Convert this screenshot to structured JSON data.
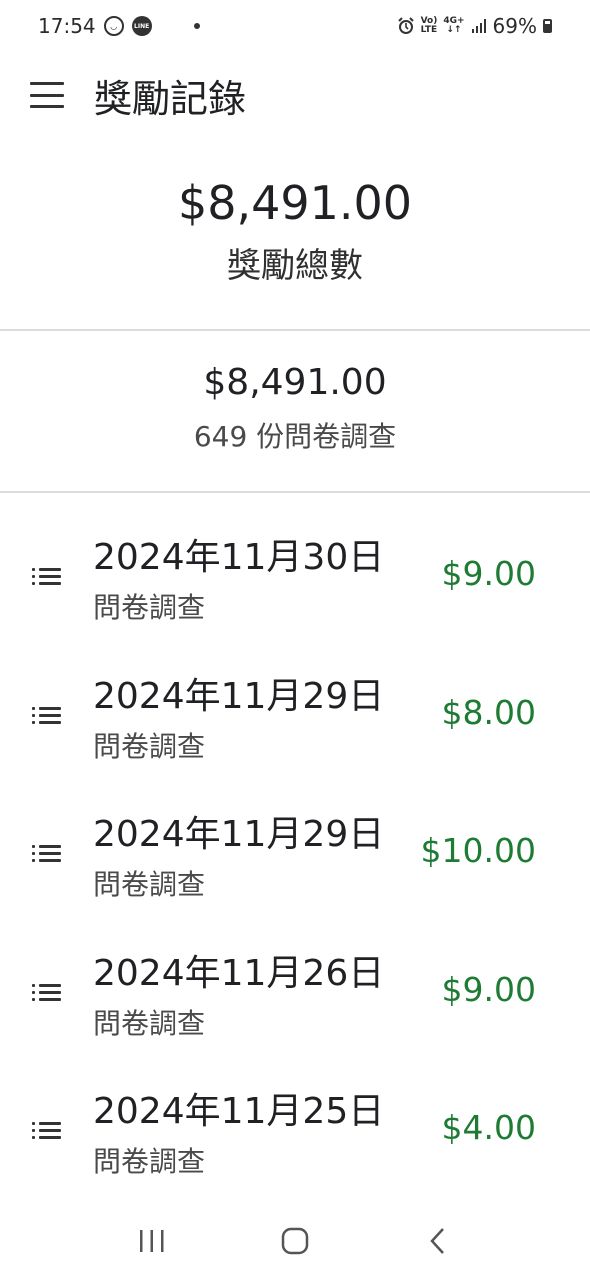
{
  "status_bar": {
    "time": "17:54",
    "app_badge": "LINE",
    "network_top": "Vo)",
    "network_bottom": "LTE",
    "data_type": "4G+",
    "battery": "69%"
  },
  "app_bar": {
    "title": "獎勵記錄"
  },
  "totals": {
    "amount": "$8,491.00",
    "label": "獎勵總數"
  },
  "summary": {
    "amount": "$8,491.00",
    "count_text": "649 份問卷調查"
  },
  "rewards": [
    {
      "date": "2024年11月30日",
      "type": "問卷調查",
      "amount": "$9.00"
    },
    {
      "date": "2024年11月29日",
      "type": "問卷調查",
      "amount": "$8.00"
    },
    {
      "date": "2024年11月29日",
      "type": "問卷調查",
      "amount": "$10.00"
    },
    {
      "date": "2024年11月26日",
      "type": "問卷調查",
      "amount": "$9.00"
    },
    {
      "date": "2024年11月25日",
      "type": "問卷調查",
      "amount": "$4.00"
    }
  ],
  "colors": {
    "amount_green": "#1e7b34",
    "divider": "#dcdcdc"
  },
  "icons": {
    "menu": "menu-icon",
    "row": "list-icon",
    "nav_recent": "recent-apps-icon",
    "nav_home": "home-icon",
    "nav_back": "back-icon"
  }
}
